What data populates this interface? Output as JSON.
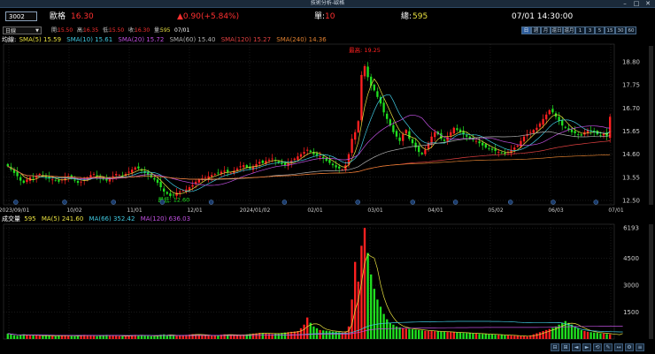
{
  "window": {
    "title": "技術分析-歐格",
    "controls": [
      "–",
      "□",
      "✕"
    ]
  },
  "symbol": {
    "code": "3002",
    "name": "歐格",
    "price": "16.30"
  },
  "change": {
    "text": "▲0.90(+5.84%)"
  },
  "single": {
    "label": "單:",
    "value": "10"
  },
  "total": {
    "label": "總:",
    "value": "595"
  },
  "datetime": "07/01 14:30:00",
  "period": {
    "selected": "日線"
  },
  "quote": {
    "open_label": "開:",
    "open": "15.50",
    "high_label": "高:",
    "high": "16.35",
    "low_label": "低:",
    "low": "15.50",
    "close_label": "收:",
    "close": "16.30",
    "vol_label": "量:",
    "vol": "595",
    "date": "07/01"
  },
  "timeframes": [
    "日",
    "週",
    "月",
    "還日",
    "還月",
    "1",
    "3",
    "5",
    "15",
    "30",
    "60"
  ],
  "ma_panel": {
    "label": "均線:",
    "items": [
      {
        "text": "SMA(5) 15.59",
        "color": "#e8e040"
      },
      {
        "text": "SMA(10) 15.61",
        "color": "#40c8e0"
      },
      {
        "text": "SMA(20) 15.72",
        "color": "#c050e0"
      },
      {
        "text": "SMA(60) 15.40",
        "color": "#b0b0b0"
      },
      {
        "text": "SMA(120) 15.27",
        "color": "#e04040"
      },
      {
        "text": "SMA(240) 14.36",
        "color": "#e08030"
      }
    ]
  },
  "vol_panel": {
    "label": "成交量",
    "value": "595",
    "items": [
      {
        "text": "MA(5) 241.60",
        "color": "#e8e040"
      },
      {
        "text": "MA(66) 352.42",
        "color": "#40c8e0"
      },
      {
        "text": "MA(120) 636.03",
        "color": "#c050e0"
      }
    ]
  },
  "annotations": {
    "high": "最高: 19.25",
    "low": "最低: 12.60"
  },
  "colors": {
    "up": "#ff2020",
    "down": "#20e020",
    "grid": "#333333",
    "axis": "#888888"
  },
  "chart_data": {
    "type": "candlestick",
    "price_axis": {
      "ticks": [
        "18.80",
        "17.75",
        "16.70",
        "15.65",
        "14.60",
        "13.55",
        "12.50"
      ],
      "ylim": [
        12.3,
        19.6
      ]
    },
    "x_ticks": [
      "2023/09/01",
      "10/02",
      "11/01",
      "12/01",
      "2024/01/02",
      "02/01",
      "03/01",
      "04/01",
      "05/02",
      "06/03",
      "07/01"
    ],
    "volume_axis": {
      "ticks": [
        "6193",
        "4500",
        "3000",
        "1500"
      ],
      "ylim": [
        0,
        6400
      ]
    },
    "closes": [
      14.05,
      13.9,
      13.75,
      13.6,
      13.4,
      13.3,
      13.45,
      13.55,
      13.5,
      13.6,
      13.7,
      13.65,
      13.55,
      13.5,
      13.45,
      13.4,
      13.35,
      13.45,
      13.55,
      13.6,
      13.5,
      13.4,
      13.3,
      13.35,
      13.45,
      13.55,
      13.65,
      13.7,
      13.6,
      13.5,
      13.45,
      13.4,
      13.5,
      13.6,
      13.7,
      13.65,
      13.6,
      13.7,
      13.8,
      13.9,
      14.0,
      13.95,
      13.85,
      13.75,
      13.65,
      13.55,
      13.45,
      13.3,
      13.1,
      12.9,
      12.8,
      12.7,
      12.75,
      12.85,
      12.9,
      12.95,
      13.0,
      13.1,
      13.2,
      13.35,
      13.45,
      13.5,
      13.55,
      13.6,
      13.65,
      13.7,
      13.75,
      13.8,
      13.85,
      13.8,
      13.75,
      13.85,
      13.95,
      14.05,
      14.1,
      14.0,
      13.95,
      14.05,
      14.15,
      14.25,
      14.2,
      14.3,
      14.35,
      14.4,
      14.3,
      14.2,
      14.15,
      14.1,
      14.2,
      14.3,
      14.4,
      14.5,
      14.6,
      14.7,
      14.8,
      14.7,
      14.6,
      14.55,
      14.5,
      14.4,
      14.3,
      14.2,
      14.1,
      14.0,
      13.95,
      13.9,
      14.1,
      14.6,
      15.3,
      15.6,
      16.1,
      18.2,
      18.6,
      18.1,
      17.7,
      17.5,
      17.2,
      16.9,
      16.5,
      16.2,
      15.9,
      15.6,
      15.4,
      15.2,
      15.5,
      15.7,
      15.3,
      15.1,
      14.9,
      14.7,
      14.6,
      14.8,
      15.1,
      15.4,
      15.6,
      15.5,
      15.3,
      15.2,
      15.4,
      15.6,
      15.8,
      15.7,
      15.6,
      15.5,
      15.4,
      15.3,
      15.25,
      15.2,
      15.1,
      15.0,
      14.9,
      14.85,
      14.8,
      14.75,
      14.7,
      14.65,
      14.6,
      14.7,
      14.8,
      14.9,
      15.0,
      15.2,
      15.4,
      15.5,
      15.6,
      15.7,
      15.8,
      16.0,
      16.2,
      16.4,
      16.6,
      16.5,
      16.3,
      16.1,
      15.9,
      15.8,
      15.7,
      15.6,
      15.55,
      15.5,
      15.45,
      15.6,
      15.7,
      15.65,
      15.6,
      15.5,
      15.45,
      15.55,
      15.4,
      16.3
    ],
    "volumes": [
      300,
      250,
      200,
      180,
      220,
      260,
      210,
      190,
      230,
      200,
      180,
      170,
      210,
      190,
      160,
      150,
      200,
      220,
      180,
      170,
      160,
      150,
      190,
      210,
      230,
      200,
      180,
      170,
      160,
      190,
      210,
      230,
      200,
      180,
      170,
      160,
      150,
      170,
      190,
      210,
      230,
      220,
      200,
      180,
      170,
      160,
      150,
      200,
      240,
      260,
      220,
      200,
      180,
      170,
      190,
      210,
      230,
      250,
      270,
      260,
      240,
      220,
      200,
      190,
      180,
      200,
      220,
      240,
      260,
      250,
      230,
      210,
      200,
      220,
      240,
      260,
      280,
      300,
      320,
      340,
      330,
      310,
      290,
      280,
      300,
      320,
      340,
      360,
      380,
      400,
      420,
      440,
      600,
      800,
      1200,
      900,
      700,
      600,
      500,
      480,
      460,
      440,
      420,
      400,
      380,
      360,
      420,
      700,
      2200,
      4300,
      3200,
      5200,
      6193,
      4800,
      3600,
      2800,
      2200,
      1800,
      1400,
      1100,
      900,
      800,
      700,
      650,
      600,
      580,
      560,
      540,
      520,
      500,
      480,
      460,
      450,
      440,
      430,
      420,
      410,
      400,
      390,
      380,
      370,
      360,
      350,
      340,
      330,
      320,
      310,
      300,
      290,
      280,
      270,
      260,
      250,
      240,
      230,
      220,
      210,
      200,
      190,
      180,
      170,
      160,
      150,
      140,
      200,
      260,
      320,
      380,
      440,
      500,
      560,
      620,
      700,
      800,
      900,
      1000,
      900,
      800,
      700,
      600,
      500,
      450,
      400,
      380,
      360,
      340,
      320,
      300,
      280,
      260,
      240,
      220,
      200,
      595
    ]
  }
}
